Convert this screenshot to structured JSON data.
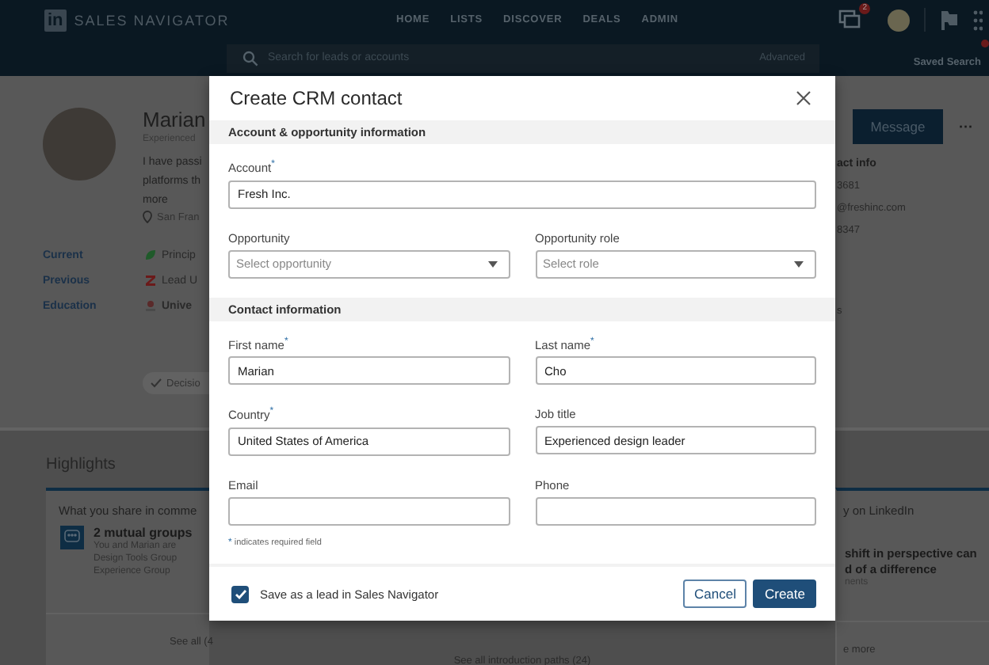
{
  "nav": {
    "logo_mark": "in",
    "brand": "SALES NAVIGATOR",
    "links": [
      {
        "label": "HOME"
      },
      {
        "label": "LISTS"
      },
      {
        "label": "DISCOVER"
      },
      {
        "label": "DEALS"
      },
      {
        "label": "ADMIN"
      }
    ],
    "message_badge": "2"
  },
  "search": {
    "placeholder": "Search for leads or accounts",
    "advanced": "Advanced",
    "saved": "Saved Search"
  },
  "profile": {
    "name": "Marian",
    "headline": "Experienced",
    "summary": [
      "I have passi",
      "platforms th",
      "more"
    ],
    "location": "San Fran",
    "experience": [
      {
        "label": "Current",
        "value": "Princip"
      },
      {
        "label": "Previous",
        "value": "Lead U"
      },
      {
        "label": "Education",
        "value": "Unive"
      }
    ],
    "tag": "Decisio",
    "message_button": "Message",
    "more_button": "···",
    "contact_title": "act info",
    "contact_lines": [
      "3681",
      "@freshinc.com",
      "8347"
    ],
    "side_note": "s"
  },
  "highlights": {
    "title": "Highlights",
    "common_title": "What you share in comme",
    "group_title": "2 mutual groups",
    "group_lines": [
      "You and Marian are",
      "Design Tools Group",
      "Experience Group"
    ],
    "left_link": "See all (4",
    "middle_link": "See all introduction paths (24)",
    "right_title": "y on LinkedIn",
    "post_lines": [
      "shift in perspective can",
      "d of a difference"
    ],
    "post_meta": "nents",
    "right_link": "e more"
  },
  "dialog": {
    "title": "Create CRM contact",
    "sections": [
      {
        "title": "Account & opportunity information",
        "rows": [
          [
            {
              "label": "Account",
              "required": true,
              "kind": "text",
              "value": "Fresh Inc."
            }
          ],
          [
            {
              "label": "Opportunity",
              "required": false,
              "kind": "select",
              "placeholder": "Select opportunity"
            },
            {
              "label": "Opportunity role",
              "required": false,
              "kind": "select",
              "placeholder": "Select role"
            }
          ]
        ]
      },
      {
        "title": "Contact information",
        "rows": [
          [
            {
              "label": "First name",
              "required": true,
              "kind": "text",
              "value": "Marian"
            },
            {
              "label": "Last name",
              "required": true,
              "kind": "text",
              "value": "Cho"
            }
          ],
          [
            {
              "label": "Country",
              "required": true,
              "kind": "text",
              "value": "United States of America"
            },
            {
              "label": "Job title",
              "required": false,
              "kind": "text",
              "value": "Experienced design leader"
            }
          ],
          [
            {
              "label": "Email",
              "required": false,
              "kind": "text"
            },
            {
              "label": "Phone",
              "required": false,
              "kind": "text"
            }
          ]
        ]
      }
    ],
    "required_mark": "*",
    "required_note": "indicates required field",
    "save_lead": {
      "label": "Save as a lead in Sales Navigator",
      "checked": true
    },
    "buttons": [
      {
        "label": "Cancel",
        "kind": "secondary"
      },
      {
        "label": "Create",
        "kind": "primary"
      }
    ]
  }
}
